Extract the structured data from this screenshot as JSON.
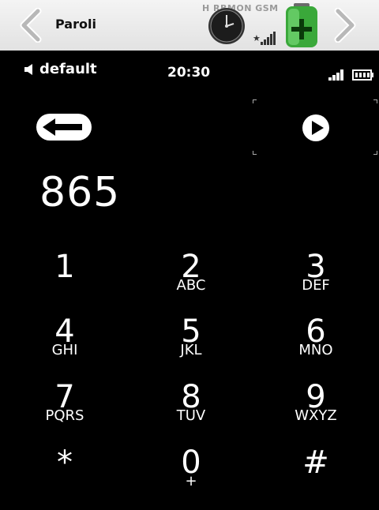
{
  "app": {
    "title": "Paroli",
    "network": "H RBMON GSM"
  },
  "status": {
    "profile": "default",
    "time": "20:30"
  },
  "dialer": {
    "number": "865",
    "keys": [
      {
        "digit": "1",
        "letters": ""
      },
      {
        "digit": "2",
        "letters": "ABC"
      },
      {
        "digit": "3",
        "letters": "DEF"
      },
      {
        "digit": "4",
        "letters": "GHI"
      },
      {
        "digit": "5",
        "letters": "JKL"
      },
      {
        "digit": "6",
        "letters": "MNO"
      },
      {
        "digit": "7",
        "letters": "PQRS"
      },
      {
        "digit": "8",
        "letters": "TUV"
      },
      {
        "digit": "9",
        "letters": "WXYZ"
      },
      {
        "digit": "*",
        "letters": ""
      },
      {
        "digit": "0",
        "letters": "+"
      },
      {
        "digit": "#",
        "letters": ""
      }
    ]
  },
  "icons": {
    "back": "chevron-left-icon",
    "forward": "chevron-right-icon",
    "clock": "clock-icon",
    "battery": "battery-charging-icon",
    "speaker": "speaker-icon",
    "backspace": "backspace-icon",
    "call": "play-icon"
  }
}
